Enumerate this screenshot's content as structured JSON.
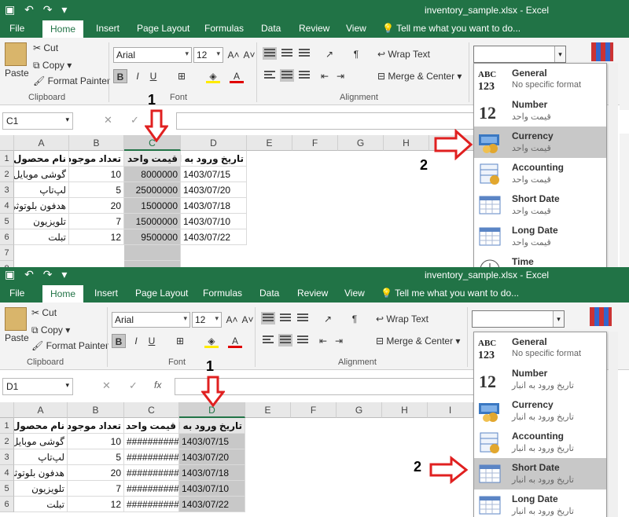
{
  "window": {
    "title": "inventory_sample.xlsx - Excel"
  },
  "tabs": [
    "File",
    "Home",
    "Insert",
    "Page Layout",
    "Formulas",
    "Data",
    "Review",
    "View"
  ],
  "tell_me": "Tell me what you want to do...",
  "clipboard": {
    "paste": "Paste",
    "cut": "Cut",
    "copy": "Copy",
    "format_painter": "Format Painter",
    "group": "Clipboard"
  },
  "font": {
    "name": "Arial",
    "size": "12",
    "bold": "B",
    "italic": "I",
    "underline": "U",
    "group": "Font"
  },
  "alignment": {
    "wrap": "Wrap Text",
    "merge": "Merge & Center",
    "group": "Alignment"
  },
  "columns": [
    "A",
    "B",
    "C",
    "D",
    "E",
    "F",
    "G",
    "H",
    "I"
  ],
  "headers": [
    "نام محصول",
    "تعداد موجودی",
    "قیمت واحد",
    "تاریخ ورود به انبار"
  ],
  "rows": [
    {
      "name": "گوشی موبایل",
      "qty": "10",
      "price": "8000000",
      "date": "1403/07/15"
    },
    {
      "name": "لپ‌تاپ",
      "qty": "5",
      "price": "25000000",
      "date": "1403/07/20"
    },
    {
      "name": "هدفون بلوتوثی",
      "qty": "20",
      "price": "1500000",
      "date": "1403/07/18"
    },
    {
      "name": "تلویزیون",
      "qty": "7",
      "price": "15000000",
      "date": "1403/07/10"
    },
    {
      "name": "تبلت",
      "qty": "12",
      "price": "9500000",
      "date": "1403/07/22"
    }
  ],
  "hash_value": "##########",
  "top": {
    "name_box": "C1",
    "row_numbers": [
      "1",
      "2",
      "3",
      "4",
      "5",
      "6",
      "7",
      "8"
    ],
    "formats": [
      {
        "title": "General",
        "sub": "No specific format",
        "icon": "abc-123-icon"
      },
      {
        "title": "Number",
        "sub": "قیمت واحد",
        "icon": "number-12-icon"
      },
      {
        "title": "Currency",
        "sub": "قیمت واحد",
        "icon": "currency-icon"
      },
      {
        "title": "Accounting",
        "sub": "قیمت واحد",
        "icon": "accounting-icon"
      },
      {
        "title": "Short Date",
        "sub": "قیمت واحد",
        "icon": "calendar-icon"
      },
      {
        "title": "Long Date",
        "sub": "قیمت واحد",
        "icon": "calendar-icon"
      },
      {
        "title": "Time",
        "sub": "",
        "icon": "clock-icon"
      }
    ],
    "step1": "1",
    "step2": "2"
  },
  "bottom": {
    "name_box": "D1",
    "fx": "fx",
    "row_numbers": [
      "1",
      "2",
      "3",
      "4",
      "5",
      "6"
    ],
    "formats": [
      {
        "title": "General",
        "sub": "No specific format",
        "icon": "abc-123-icon"
      },
      {
        "title": "Number",
        "sub": "تاریخ ورود به انبار",
        "icon": "number-12-icon"
      },
      {
        "title": "Currency",
        "sub": "تاریخ ورود به انبار",
        "icon": "currency-icon"
      },
      {
        "title": "Accounting",
        "sub": "تاریخ ورود به انبار",
        "icon": "accounting-icon"
      },
      {
        "title": "Short Date",
        "sub": "تاریخ ورود به انبار",
        "icon": "calendar-icon"
      },
      {
        "title": "Long Date",
        "sub": "تاریخ ورود به انبار",
        "icon": "calendar-icon"
      }
    ],
    "step1": "1",
    "step2": "2"
  },
  "colors": {
    "excel_green": "#217346",
    "arrow_red": "#e02020",
    "selection_gray": "#c8c8c8"
  }
}
